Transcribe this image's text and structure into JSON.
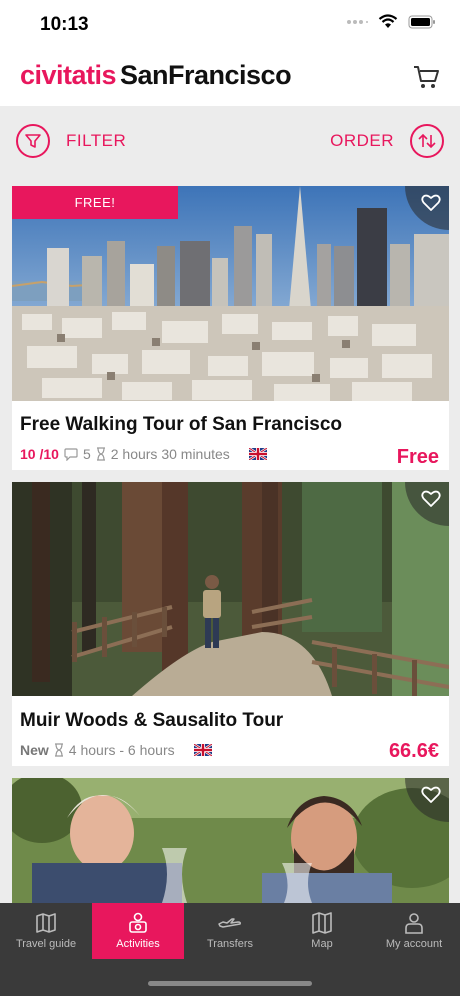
{
  "status": {
    "time": "10:13"
  },
  "header": {
    "brand": "civitatis",
    "city": "SanFrancisco",
    "cart_icon": "cart-icon"
  },
  "toolbar": {
    "filter_label": "FILTER",
    "order_label": "ORDER"
  },
  "cards": [
    {
      "badge": "FREE!",
      "title": "Free Walking Tour of San Francisco",
      "rating": "10 /10",
      "reviews": "5",
      "duration": "2 hours 30 minutes",
      "price": "Free"
    },
    {
      "tag": "New",
      "title": "Muir Woods & Sausalito Tour",
      "duration": "4 hours - 6 hours",
      "price": "66.6€"
    }
  ],
  "tabs": [
    {
      "label": "Travel guide",
      "icon": "map-book-icon"
    },
    {
      "label": "Activities",
      "icon": "activities-icon"
    },
    {
      "label": "Transfers",
      "icon": "plane-icon"
    },
    {
      "label": "Map",
      "icon": "map-icon"
    },
    {
      "label": "My account",
      "icon": "user-icon"
    }
  ],
  "colors": {
    "accent": "#e8175d",
    "tabbar": "#3a3a3a"
  }
}
